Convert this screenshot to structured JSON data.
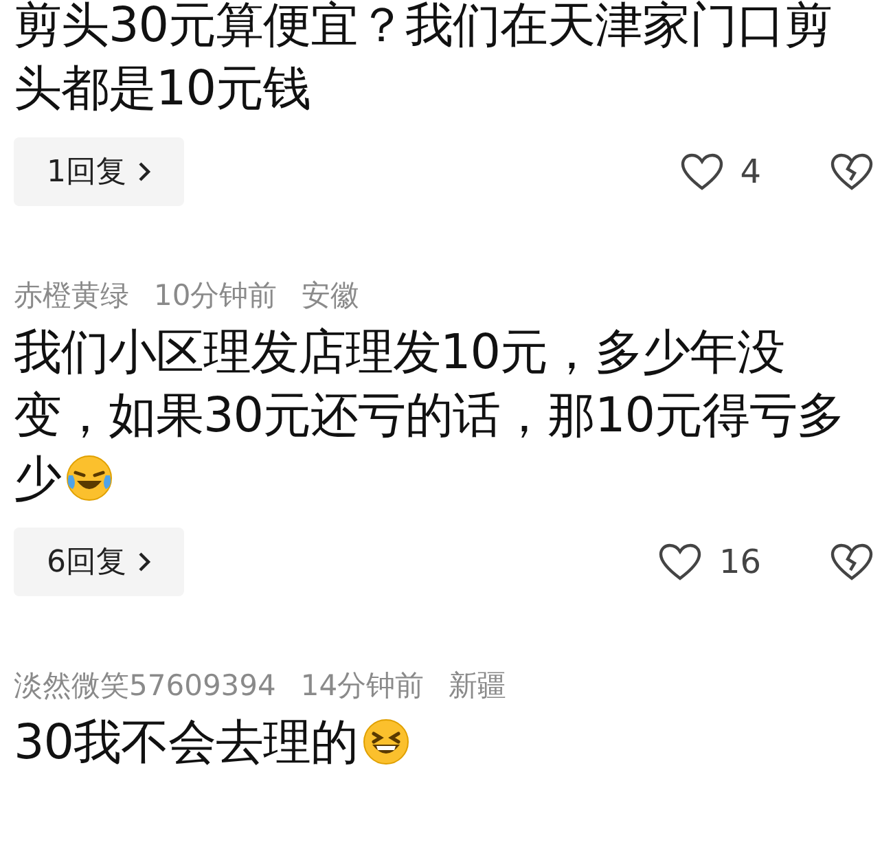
{
  "comments": [
    {
      "text": "剪头30元算便宜？我们在天津家门口剪头都是10元钱",
      "replies": "1回复",
      "likes": "4"
    },
    {
      "author": "赤橙黄绿",
      "time": "10分钟前",
      "location": "安徽",
      "text": "我们小区理发店理发10元，多少年没变，如果30元还亏的话，那10元得亏多少",
      "emoji": {
        "kind": "laugh-cry"
      },
      "replies": "6回复",
      "likes": "16"
    },
    {
      "author": "淡然微笑57609394",
      "time": "14分钟前",
      "location": "新疆",
      "text": "30我不会去理的",
      "emoji": {
        "kind": "grin"
      }
    }
  ]
}
